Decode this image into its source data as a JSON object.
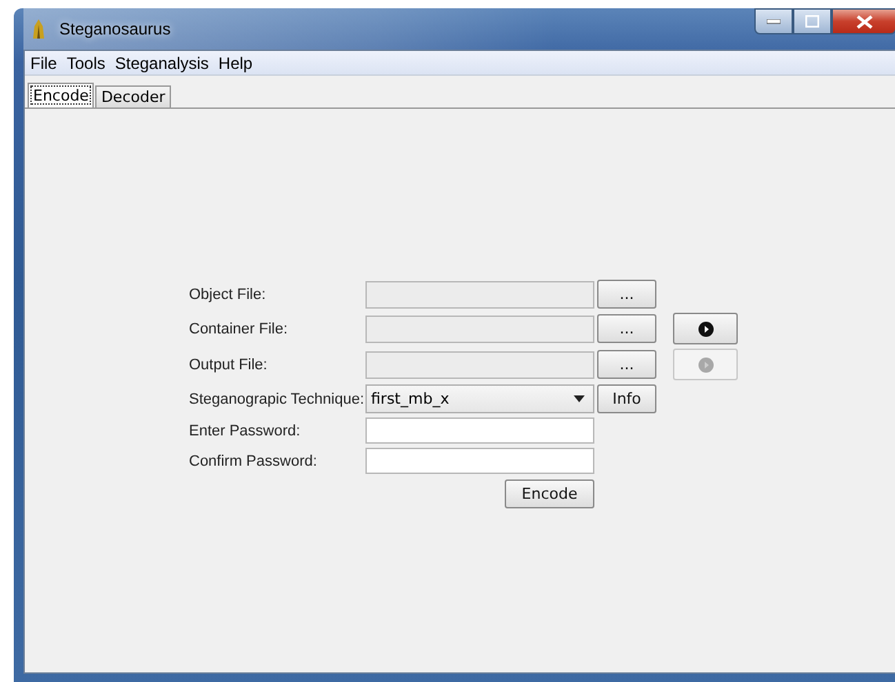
{
  "window": {
    "title": "Steganosaurus"
  },
  "menu": [
    "File",
    "Tools",
    "Steganalysis",
    "Help"
  ],
  "tabs": [
    {
      "label": "Encode",
      "selected": true
    },
    {
      "label": "Decoder",
      "selected": false
    }
  ],
  "form": {
    "rows": [
      {
        "kind": "file",
        "label": "Object File:",
        "browse": "...",
        "disabled": true
      },
      {
        "kind": "file",
        "label": "Container File:",
        "browse": "...",
        "disabled": true,
        "play": {
          "disabled": false
        }
      },
      {
        "kind": "file",
        "label": "Output File:",
        "browse": "...",
        "disabled": true,
        "play": {
          "disabled": true
        }
      },
      {
        "kind": "select",
        "label": "Steganograpic Technique:",
        "value": "first_mb_x",
        "button": "Info"
      },
      {
        "kind": "password",
        "label": "Enter Password:",
        "disabled": false
      },
      {
        "kind": "password",
        "label": "Confirm Password:",
        "disabled": false
      }
    ],
    "submit": "Encode"
  }
}
